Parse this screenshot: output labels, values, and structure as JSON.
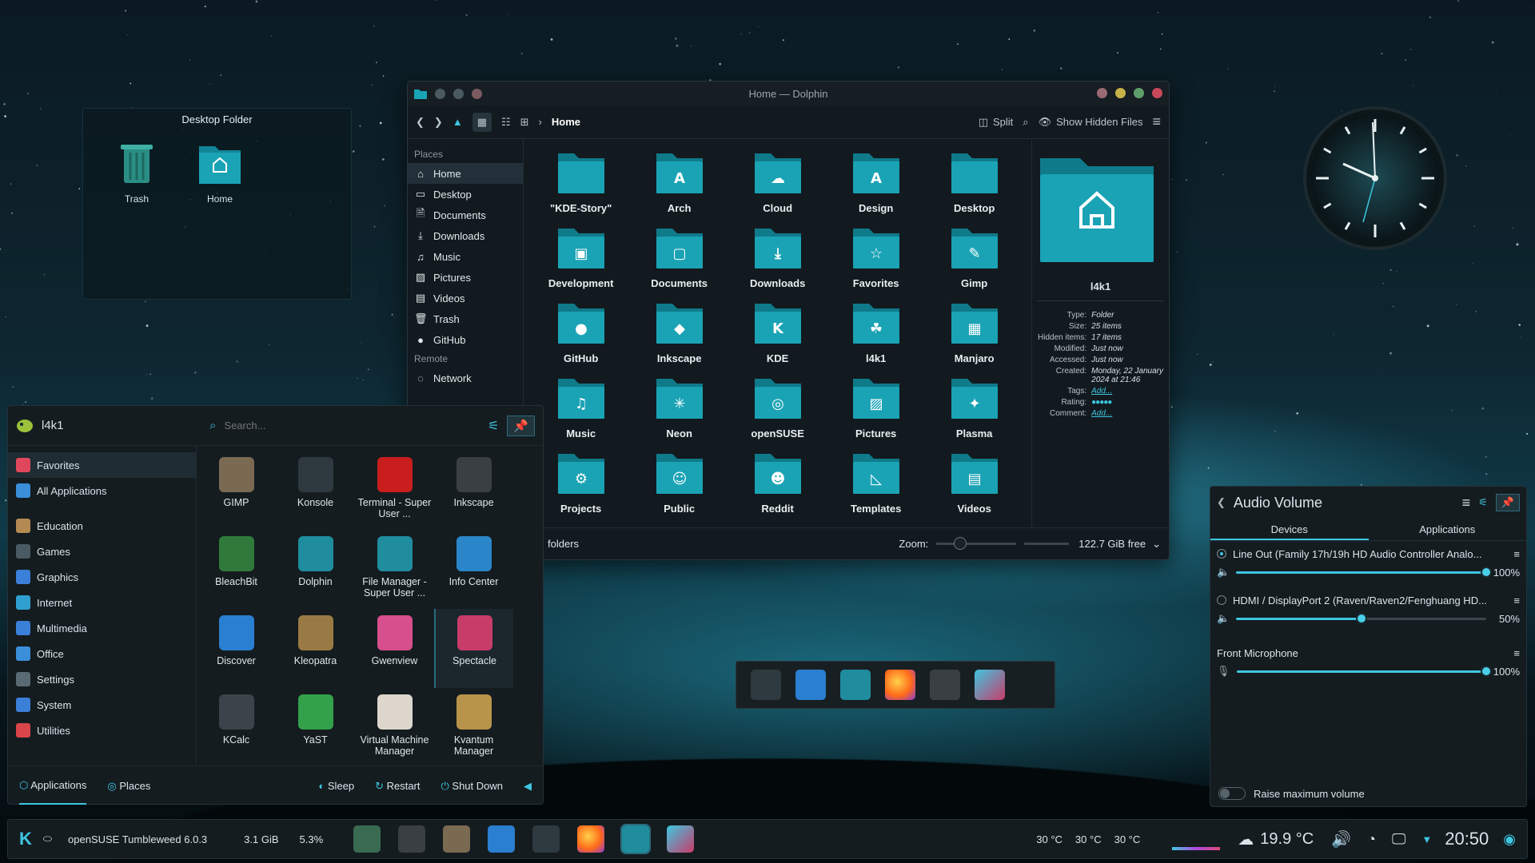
{
  "desktop_folder": {
    "title": "Desktop Folder",
    "items": [
      {
        "label": "Trash"
      },
      {
        "label": "Home"
      }
    ]
  },
  "dolphin": {
    "window_title": "Home — Dolphin",
    "breadcrumb": "Home",
    "split_label": "Split",
    "hidden_files_label": "Show Hidden Files",
    "places_section": "Places",
    "remote_section": "Remote",
    "places": [
      {
        "label": "Home",
        "icon": "home-icon"
      },
      {
        "label": "Desktop",
        "icon": "desktop-icon"
      },
      {
        "label": "Documents",
        "icon": "documents-icon"
      },
      {
        "label": "Downloads",
        "icon": "downloads-icon"
      },
      {
        "label": "Music",
        "icon": "music-icon"
      },
      {
        "label": "Pictures",
        "icon": "pictures-icon"
      },
      {
        "label": "Videos",
        "icon": "videos-icon"
      },
      {
        "label": "Trash",
        "icon": "trash-icon"
      },
      {
        "label": "GitHub",
        "icon": "github-icon"
      }
    ],
    "remote": [
      {
        "label": "Network",
        "icon": "network-icon"
      }
    ],
    "folders": [
      {
        "label": "\"KDE-Story\"",
        "glyph": ""
      },
      {
        "label": "Arch",
        "glyph": "A"
      },
      {
        "label": "Cloud",
        "glyph": "☁"
      },
      {
        "label": "Design",
        "glyph": "A"
      },
      {
        "label": "Desktop",
        "glyph": ""
      },
      {
        "label": "Development",
        "glyph": "▣"
      },
      {
        "label": "Documents",
        "glyph": "▢"
      },
      {
        "label": "Downloads",
        "glyph": "⤓"
      },
      {
        "label": "Favorites",
        "glyph": "☆"
      },
      {
        "label": "Gimp",
        "glyph": "✎"
      },
      {
        "label": "GitHub",
        "glyph": "●"
      },
      {
        "label": "Inkscape",
        "glyph": "◆"
      },
      {
        "label": "KDE",
        "glyph": "K"
      },
      {
        "label": "l4k1",
        "glyph": "☘"
      },
      {
        "label": "Manjaro",
        "glyph": "▦"
      },
      {
        "label": "Music",
        "glyph": "♫"
      },
      {
        "label": "Neon",
        "glyph": "✳"
      },
      {
        "label": "openSUSE",
        "glyph": "◎"
      },
      {
        "label": "Pictures",
        "glyph": "▨"
      },
      {
        "label": "Plasma",
        "glyph": "✦"
      },
      {
        "label": "Projects",
        "glyph": "⚙"
      },
      {
        "label": "Public",
        "glyph": "☺"
      },
      {
        "label": "Reddit",
        "glyph": "☻"
      },
      {
        "label": "Templates",
        "glyph": "◺"
      },
      {
        "label": "Videos",
        "glyph": "▤"
      }
    ],
    "info": {
      "name": "l4k1",
      "rows": [
        {
          "k": "Type:",
          "v": "Folder"
        },
        {
          "k": "Size:",
          "v": "25 items"
        },
        {
          "k": "Hidden items:",
          "v": "17 items"
        },
        {
          "k": "Modified:",
          "v": "Just now"
        },
        {
          "k": "Accessed:",
          "v": "Just now"
        },
        {
          "k": "Created:",
          "v": "Monday, 22 January 2024 at 21:46"
        }
      ],
      "tags_label": "Tags:",
      "tags_value": "Add...",
      "rating_label": "Rating:",
      "comment_label": "Comment:",
      "comment_value": "Add..."
    },
    "status": {
      "text": "folders",
      "zoom_label": "Zoom:",
      "free": "122.7 GiB free"
    }
  },
  "menu": {
    "user": "l4k1",
    "search_placeholder": "Search...",
    "categories": [
      {
        "label": "Favorites",
        "color": "#e0475c"
      },
      {
        "label": "All Applications",
        "color": "#3a8fd8"
      },
      {
        "label": "Education",
        "color": "#b38a52"
      },
      {
        "label": "Games",
        "color": "#4a5a62"
      },
      {
        "label": "Graphics",
        "color": "#3a7fd8"
      },
      {
        "label": "Internet",
        "color": "#2f9fd0"
      },
      {
        "label": "Multimedia",
        "color": "#3a7fd8"
      },
      {
        "label": "Office",
        "color": "#3a8fd8"
      },
      {
        "label": "Settings",
        "color": "#5a6a72"
      },
      {
        "label": "System",
        "color": "#3a7fd8"
      },
      {
        "label": "Utilities",
        "color": "#d8454a"
      }
    ],
    "apps": [
      {
        "label": "GIMP",
        "color": "#7a6a52"
      },
      {
        "label": "Konsole",
        "color": "#2e3a40"
      },
      {
        "label": "Terminal - Super User ...",
        "color": "#c81e1e"
      },
      {
        "label": "Inkscape",
        "color": "#3a3f44"
      },
      {
        "label": "BleachBit",
        "color": "#2f7a3a"
      },
      {
        "label": "Dolphin",
        "color": "#1f8d9e"
      },
      {
        "label": "File Manager - Super User ...",
        "color": "#1f8d9e"
      },
      {
        "label": "Info Center",
        "color": "#2a86c8"
      },
      {
        "label": "Discover",
        "color": "#2a7fd0"
      },
      {
        "label": "Kleopatra",
        "color": "#9a7a44"
      },
      {
        "label": "Gwenview",
        "color": "#d74f8c"
      },
      {
        "label": "Spectacle",
        "color": "#c83c6a"
      },
      {
        "label": "KCalc",
        "color": "#3a444a"
      },
      {
        "label": "YaST",
        "color": "#33a04a"
      },
      {
        "label": "Virtual Machine Manager",
        "color": "#ddd6cc"
      },
      {
        "label": "Kvantum Manager",
        "color": "#b8944a"
      }
    ],
    "footer": {
      "applications": "Applications",
      "places": "Places",
      "sleep": "Sleep",
      "restart": "Restart",
      "shutdown": "Shut Down"
    }
  },
  "audio": {
    "title": "Audio Volume",
    "tabs": [
      "Devices",
      "Applications"
    ],
    "devices": [
      {
        "name": "Line Out (Family 17h/19h HD Audio Controller Analo...",
        "pct": "100%",
        "level": 1.0
      },
      {
        "name": "HDMI / DisplayPort 2 (Raven/Raven2/Fenghuang HD...",
        "pct": "50%",
        "level": 0.5
      }
    ],
    "mic": {
      "name": "Front Microphone",
      "pct": "100%",
      "level": 1.0
    },
    "raise_label": "Raise maximum volume"
  },
  "panel": {
    "distro": "openSUSE Tumbleweed 6.0.3",
    "mem": "3.1 GiB",
    "cpu": "5.3%",
    "temps": [
      "30 °C",
      "30 °C",
      "30 °C"
    ],
    "weather": "19.9 °C",
    "time": "20:50"
  },
  "colors": {
    "accent": "#3ec6e0",
    "folder": "#178a9c"
  }
}
